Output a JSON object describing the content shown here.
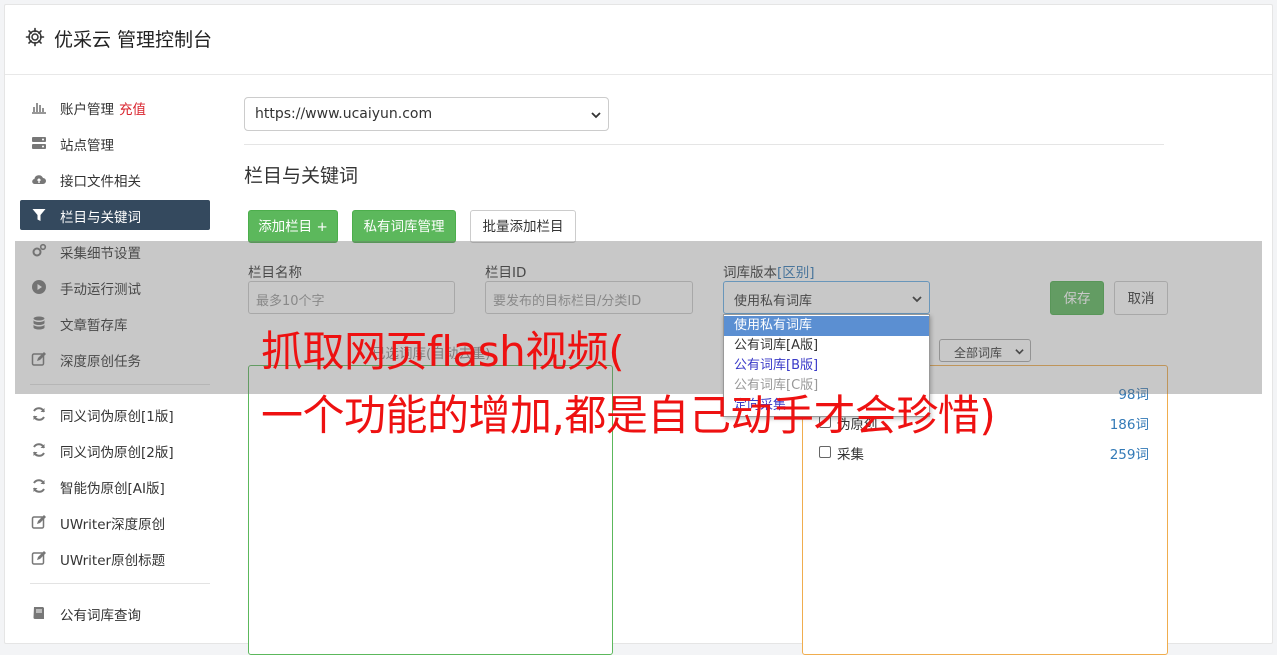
{
  "header": {
    "title": "优采云 管理控制台",
    "icon": "gear-icon"
  },
  "sidebar": {
    "items": [
      {
        "label": "账户管理",
        "badge": "充值",
        "icon": "bar-chart-icon"
      },
      {
        "label": "站点管理",
        "icon": "server-icon"
      },
      {
        "label": "接口文件相关",
        "icon": "cloud-upload-icon"
      },
      {
        "label": "栏目与关键词",
        "icon": "filter-icon",
        "active": true
      },
      {
        "label": "采集细节设置",
        "icon": "gears-icon"
      },
      {
        "label": "手动运行测试",
        "icon": "play-circle-icon"
      },
      {
        "label": "文章暂存库",
        "icon": "database-icon"
      },
      {
        "label": "深度原创任务",
        "icon": "edit-icon"
      }
    ],
    "items2": [
      {
        "label": "同义词伪原创[1版]",
        "icon": "refresh-icon"
      },
      {
        "label": "同义词伪原创[2版]",
        "icon": "refresh-icon"
      },
      {
        "label": "智能伪原创[AI版]",
        "icon": "refresh-icon"
      },
      {
        "label": "UWriter深度原创",
        "icon": "edit-icon"
      },
      {
        "label": "UWriter原创标题",
        "icon": "edit-icon"
      }
    ],
    "items3": [
      {
        "label": "公有词库查询",
        "icon": "book-icon"
      }
    ]
  },
  "main": {
    "site_select": "https://www.ucaiyun.com",
    "section_title": "栏目与关键词",
    "buttons": {
      "add_column": "添加栏目 +",
      "private_lib": "私有词库管理",
      "batch_add": "批量添加栏目"
    },
    "form": {
      "name_label": "栏目名称",
      "name_placeholder": "最多10个字",
      "id_label": "栏目ID",
      "id_placeholder": "要发布的目标栏目/分类ID",
      "version_label": "词库版本",
      "version_diff": "[区别]",
      "version_value": "使用私有词库",
      "save": "保存",
      "cancel": "取消"
    },
    "dropdown_options": [
      "使用私有词库",
      "公有词库[A版]",
      "公有词库[B版]",
      "公有词库[C版]",
      "定向采集"
    ],
    "pick_label": "已选词库(自动去重)",
    "lib_filter": "全部词库",
    "libraries": [
      {
        "name": "",
        "count": "98词"
      },
      {
        "name": "伪原创",
        "count": "186词"
      },
      {
        "name": "采集",
        "count": "259词"
      }
    ]
  },
  "watermark": {
    "line1": "抓取网页flash视频(",
    "line2": "一个功能的增加,都是自己动手才会珍惜)"
  },
  "colors": {
    "accent_green": "#5cb85c",
    "nav_active": "#34495e",
    "link_blue": "#337ab7",
    "warn_orange": "#f0ad4e",
    "watermark_red": "#ee1111"
  }
}
